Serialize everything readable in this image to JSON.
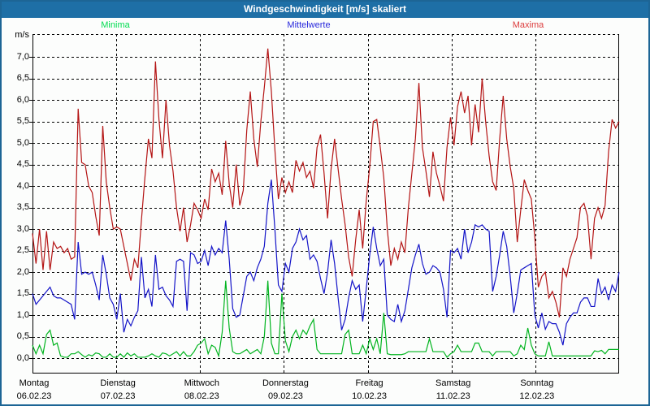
{
  "window": {
    "title": "Windgeschwindigkeit [m/s] skaliert"
  },
  "legend": [
    {
      "label": "Minima",
      "color": "#00dc50"
    },
    {
      "label": "Mittelwerte",
      "color": "#2828dc"
    },
    {
      "label": "Maxima",
      "color": "#dc3c3c"
    }
  ],
  "axis": {
    "unit_label": "m/s",
    "y_tick_labels": [
      "7,0",
      "6,5",
      "6,0",
      "5,5",
      "5,0",
      "4,5",
      "4,0",
      "3,5",
      "3,0",
      "2,5",
      "2,0",
      "1,5",
      "1,0",
      "0,5",
      "0,0"
    ]
  },
  "chart_data": {
    "type": "line",
    "title": "Windgeschwindigkeit [m/s] skaliert",
    "ylabel": "m/s",
    "ylim": [
      -0.45,
      7.55
    ],
    "y_tick_step": 0.5,
    "y_ticks": [
      0,
      0.5,
      1,
      1.5,
      2,
      2.5,
      3,
      3.5,
      4,
      4.5,
      5,
      5.5,
      6,
      6.5,
      7
    ],
    "grid": "dashed",
    "legend_position": "top",
    "x_resolution_hours": 1,
    "x_days": [
      {
        "day": "Montag",
        "date": "06.02.23"
      },
      {
        "day": "Dienstag",
        "date": "07.02.23"
      },
      {
        "day": "Mittwoch",
        "date": "08.02.23"
      },
      {
        "day": "Donnerstag",
        "date": "09.02.23"
      },
      {
        "day": "Freitag",
        "date": "10.02.23"
      },
      {
        "day": "Samstag",
        "date": "11.02.23"
      },
      {
        "day": "Sonntag",
        "date": "12.02.23"
      }
    ],
    "series": [
      {
        "name": "Minima",
        "color": "#00b41e",
        "values": [
          0.3,
          0.1,
          0.3,
          0.1,
          0.55,
          0.65,
          0.3,
          0.35,
          0.05,
          0.02,
          0.02,
          0.1,
          0.1,
          0.15,
          0.08,
          0.02,
          0.08,
          0.05,
          0.12,
          0.1,
          0.02,
          0.02,
          0.1,
          0.02,
          0.02,
          0.1,
          0.02,
          0.12,
          0.05,
          0.1,
          0.02,
          0.02,
          0.02,
          0.05,
          0.1,
          0.05,
          0.02,
          0.12,
          0.1,
          0.05,
          0.1,
          0.15,
          0.05,
          0.15,
          0.05,
          0.05,
          0.15,
          0.3,
          0.35,
          0.45,
          0.1,
          0.3,
          0.25,
          0.05,
          0.6,
          1.8,
          0.7,
          0.15,
          0.1,
          0.1,
          0.15,
          0.2,
          0.1,
          0.15,
          0.2,
          0.1,
          0.5,
          1.8,
          0.35,
          0.1,
          0.1,
          1.5,
          0.4,
          0.15,
          0.5,
          0.65,
          0.45,
          0.65,
          0.55,
          0.75,
          0.9,
          0.2,
          0.1,
          0.1,
          0.1,
          0.1,
          0.1,
          0.1,
          0.1,
          0.55,
          0.65,
          0.1,
          0.1,
          0.1,
          0.3,
          0.1,
          0.45,
          0.2,
          0.45,
          0.1,
          1.05,
          0.1,
          0.08,
          0.08,
          0.08,
          0.08,
          0.1,
          0.15,
          0.15,
          0.15,
          0.15,
          0.15,
          0.15,
          0.45,
          0.15,
          0.15,
          0.15,
          0.15,
          0.02,
          0.1,
          0.15,
          0.3,
          0.15,
          0.15,
          0.15,
          0.15,
          0.35,
          0.35,
          0.15,
          0.15,
          0.15,
          0.05,
          0.15,
          0.15,
          0.15,
          0.15,
          0.15,
          0.05,
          0.1,
          0.3,
          0.2,
          0.7,
          0.3,
          0.1,
          0.05,
          0.05,
          0.05,
          0.38,
          0.05,
          0.05,
          0.05,
          0.05,
          0.05,
          0.05,
          0.05,
          0.05,
          0.05,
          0.05,
          0.05,
          0.05,
          0.17,
          0.15,
          0.18,
          0.1,
          0.2,
          0.2,
          0.2,
          0.2
        ]
      },
      {
        "name": "Mittelwerte",
        "color": "#1414c8",
        "values": [
          1.5,
          1.25,
          1.35,
          1.45,
          1.55,
          1.65,
          1.45,
          1.4,
          1.4,
          1.35,
          1.3,
          1.25,
          0.9,
          2.7,
          1.95,
          2.0,
          1.95,
          2.0,
          1.7,
          1.35,
          2.4,
          1.95,
          1.4,
          1.25,
          0.9,
          1.5,
          0.6,
          0.9,
          0.75,
          0.95,
          1.1,
          2.35,
          1.4,
          1.6,
          1.2,
          2.4,
          1.6,
          1.65,
          1.45,
          1.35,
          1.2,
          2.25,
          2.3,
          2.25,
          1.1,
          2.45,
          2.4,
          2.2,
          2.25,
          2.5,
          2.15,
          2.6,
          2.4,
          2.55,
          2.45,
          3.2,
          2.3,
          1.15,
          0.95,
          1.0,
          1.45,
          1.9,
          2.0,
          1.8,
          2.1,
          2.3,
          2.6,
          3.6,
          4.15,
          3.0,
          1.7,
          1.55,
          2.2,
          2.0,
          2.55,
          2.7,
          3.0,
          2.75,
          2.85,
          2.3,
          2.4,
          2.25,
          1.85,
          1.5,
          2.0,
          2.75,
          2.2,
          1.4,
          0.65,
          0.9,
          1.4,
          1.8,
          1.6,
          1.7,
          0.85,
          1.6,
          2.4,
          3.05,
          2.55,
          2.15,
          2.3,
          1.0,
          0.9,
          0.85,
          1.25,
          0.85,
          1.1,
          1.6,
          2.1,
          2.4,
          2.65,
          2.2,
          1.95,
          2.0,
          2.15,
          2.1,
          2.0,
          1.6,
          0.95,
          2.5,
          2.45,
          2.55,
          2.3,
          3.0,
          2.45,
          2.7,
          3.1,
          3.05,
          3.1,
          3.0,
          2.95,
          1.55,
          1.9,
          2.4,
          2.95,
          2.6,
          1.9,
          1.05,
          1.5,
          2.05,
          2.1,
          2.15,
          2.2,
          1.0,
          0.7,
          1.05,
          0.67,
          0.85,
          0.8,
          0.8,
          0.6,
          0.3,
          0.8,
          0.95,
          1.05,
          1.05,
          1.3,
          1.4,
          1.4,
          1.2,
          1.2,
          1.85,
          1.5,
          1.65,
          1.35,
          1.7,
          1.55,
          2.0
        ]
      },
      {
        "name": "Maxima",
        "color": "#b41414",
        "values": [
          2.9,
          2.2,
          3.0,
          2.05,
          2.95,
          2.05,
          2.7,
          2.55,
          2.6,
          2.45,
          2.55,
          2.3,
          2.35,
          5.8,
          4.55,
          4.5,
          4.0,
          3.85,
          3.3,
          2.85,
          5.4,
          4.1,
          3.5,
          3.0,
          3.05,
          3.0,
          2.6,
          2.2,
          1.8,
          2.3,
          2.1,
          3.2,
          4.2,
          5.1,
          4.65,
          6.9,
          5.55,
          4.65,
          6.0,
          4.95,
          4.35,
          3.5,
          2.95,
          3.5,
          2.7,
          3.1,
          3.6,
          3.45,
          3.25,
          3.7,
          3.45,
          4.4,
          4.1,
          4.3,
          3.8,
          5.05,
          4.05,
          3.5,
          4.5,
          3.55,
          3.9,
          5.3,
          6.2,
          5.1,
          4.45,
          5.5,
          6.3,
          7.2,
          6.2,
          4.85,
          3.7,
          4.2,
          3.85,
          4.1,
          3.85,
          4.6,
          4.35,
          4.55,
          4.2,
          4.35,
          3.95,
          4.9,
          5.2,
          4.3,
          3.25,
          4.4,
          5.1,
          4.4,
          3.7,
          3.1,
          2.35,
          1.9,
          2.75,
          3.45,
          2.55,
          3.65,
          4.45,
          5.5,
          5.55,
          4.9,
          4.2,
          3.0,
          2.15,
          2.55,
          2.3,
          2.7,
          2.45,
          3.5,
          4.3,
          5.1,
          6.4,
          4.9,
          4.35,
          3.75,
          4.8,
          4.3,
          4.0,
          3.65,
          4.9,
          5.6,
          4.95,
          5.85,
          6.2,
          5.7,
          6.1,
          4.95,
          5.9,
          5.25,
          6.5,
          5.5,
          4.7,
          4.1,
          3.9,
          5.1,
          6.1,
          5.1,
          4.45,
          3.95,
          2.7,
          3.45,
          4.15,
          3.9,
          3.7,
          2.8,
          1.65,
          1.9,
          2.0,
          1.4,
          1.55,
          1.3,
          0.95,
          2.1,
          1.9,
          2.3,
          2.55,
          2.8,
          3.5,
          3.6,
          3.3,
          2.3,
          3.25,
          3.5,
          3.25,
          3.55,
          4.8,
          5.55,
          5.35,
          5.5
        ]
      }
    ]
  },
  "colors": {
    "titlebar": "#1e6fa6",
    "window_border": "#1d6595",
    "background": "#fcfdfc",
    "grid": "#000000"
  }
}
